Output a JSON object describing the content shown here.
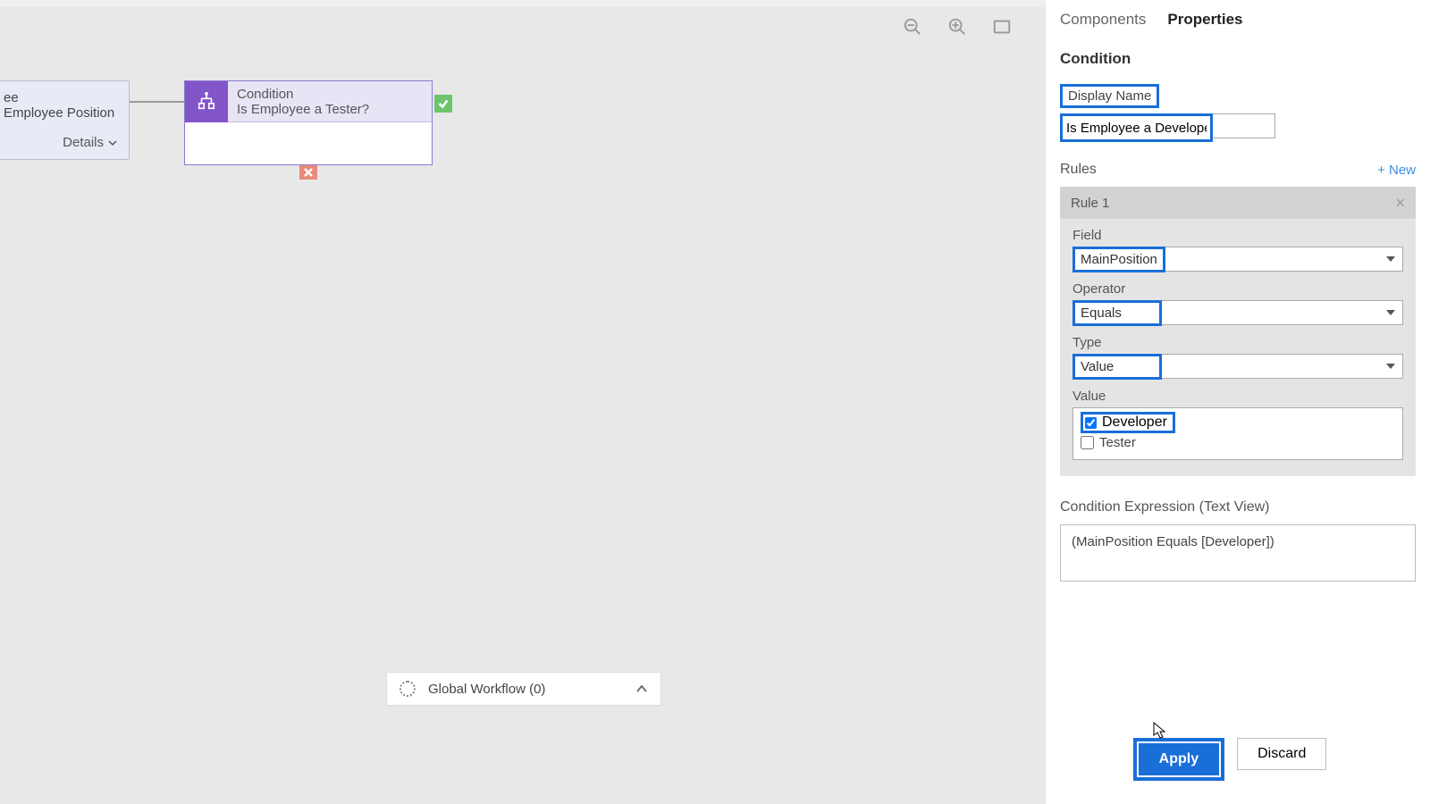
{
  "canvas": {
    "prev_node": {
      "line1": "ee",
      "line2": "Employee Position",
      "details": "Details"
    },
    "condition": {
      "label": "Condition",
      "title": "Is Employee a Tester?"
    },
    "global_workflow": "Global Workflow (0)"
  },
  "panel": {
    "tabs": {
      "components": "Components",
      "properties": "Properties"
    },
    "section": "Condition",
    "display_name_label": "Display Name",
    "display_name_value": "Is Employee a Developer?",
    "rules_label": "Rules",
    "new_label": "+ New",
    "rule": {
      "title": "Rule 1",
      "field_label": "Field",
      "field_value": "MainPosition",
      "operator_label": "Operator",
      "operator_value": "Equals",
      "type_label": "Type",
      "type_value": "Value",
      "value_label": "Value",
      "value_options": {
        "developer": "Developer",
        "tester": "Tester"
      }
    },
    "expr_label": "Condition Expression (Text View)",
    "expr_value": "(MainPosition Equals [Developer])",
    "apply": "Apply",
    "discard": "Discard"
  }
}
